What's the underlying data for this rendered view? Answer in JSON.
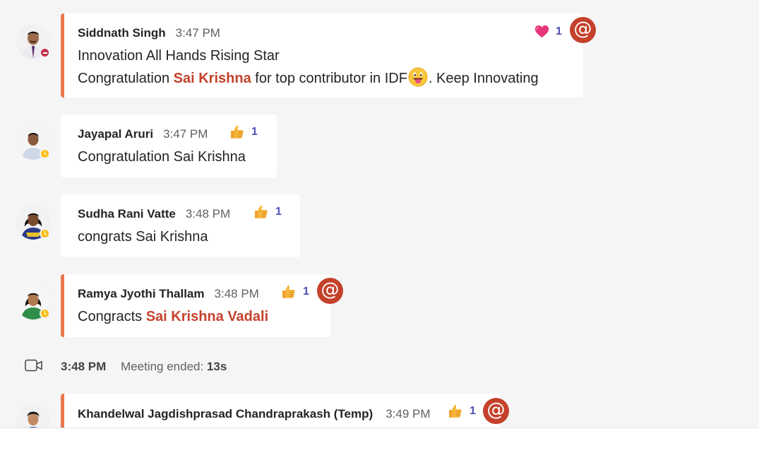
{
  "messages": [
    {
      "author": "Siddnath Singh",
      "time": "3:47 PM",
      "line1": "Innovation All Hands Rising Star",
      "line2_pre": "Congratulation ",
      "line2_mention": "Sai Krishna",
      "line2_mid": " for top contributor in IDF",
      "line2_post": ". Keep Innovating",
      "reaction_icon": "heart-icon",
      "reaction_count": "1",
      "presence": "do-not-disturb",
      "mentions_me": true
    },
    {
      "author": "Jayapal Aruri",
      "time": "3:47 PM",
      "text": "Congratulation Sai Krishna",
      "reaction_icon": "thumbs-up-icon",
      "reaction_count": "1",
      "presence": "away"
    },
    {
      "author": "Sudha Rani Vatte",
      "time": "3:48 PM",
      "text": "congrats Sai Krishna",
      "reaction_icon": "thumbs-up-icon",
      "reaction_count": "1",
      "presence": "away"
    },
    {
      "author": "Ramya Jyothi Thallam",
      "time": "3:48 PM",
      "text_pre": "Congracts ",
      "text_mention": "Sai Krishna Vadali",
      "reaction_icon": "thumbs-up-icon",
      "reaction_count": "1",
      "presence": "away",
      "mentions_me": true
    },
    {
      "author": "Khandelwal Jagdishprasad Chandraprakash (Temp)",
      "time": "3:49 PM",
      "reaction_icon": "thumbs-up-icon",
      "reaction_count": "1",
      "mentions_me": true
    }
  ],
  "system_event": {
    "icon": "video-camera-icon",
    "time": "3:48 PM",
    "label": "Meeting ended: ",
    "duration": "13s"
  },
  "at_symbol": "@",
  "colors": {
    "mention_accent": "#e9784f",
    "mention_text": "#c4412b",
    "reaction_count": "#4f52b2",
    "dnd": "#c4314b",
    "away": "#f8c01a"
  }
}
